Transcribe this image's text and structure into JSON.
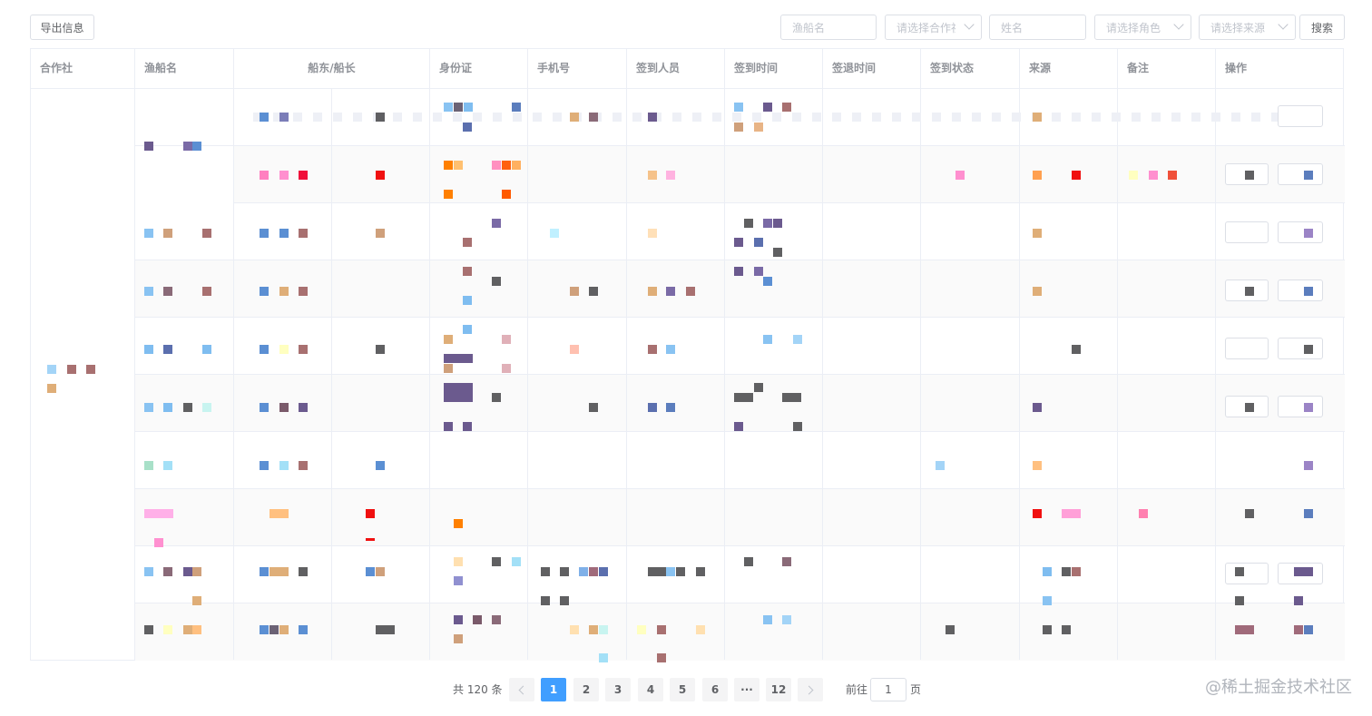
{
  "toolbar": {
    "export_label": "导出信息",
    "boat_name_placeholder": "渔船名",
    "coop_select_placeholder": "请选择合作社",
    "name_placeholder": "姓名",
    "role_select_placeholder": "请选择角色",
    "source_select_placeholder": "请选择来源",
    "search_label": "搜索"
  },
  "table": {
    "columns": [
      "合作社",
      "渔船名",
      "船东/船长",
      "身份证",
      "手机号",
      "签到人员",
      "签到时间",
      "签退时间",
      "签到状态",
      "来源",
      "备注",
      "操作"
    ]
  },
  "pagination": {
    "total_text": "共 120 条",
    "pages": [
      "1",
      "2",
      "3",
      "4",
      "5",
      "6",
      "···",
      "12"
    ],
    "current_page": "1",
    "goto_prefix": "前往",
    "goto_value": "1",
    "goto_suffix": "页"
  },
  "watermark": "@稀土掘金技术社区",
  "colors": {
    "accent": "#409eff",
    "border": "#ebeef5",
    "header_text": "#909399",
    "stripe": "#fafafa"
  }
}
